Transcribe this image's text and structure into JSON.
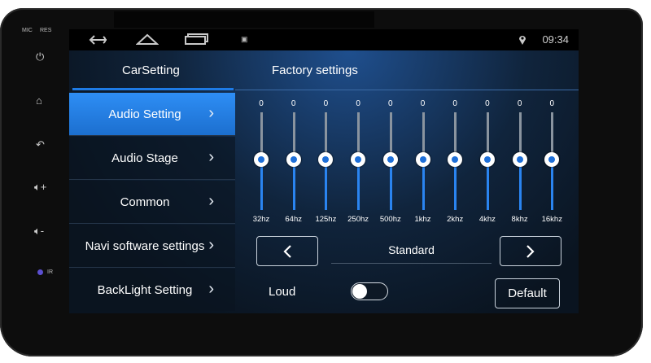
{
  "hardware": {
    "mic_label": "MIC",
    "res_label": "RES",
    "ir_label": "IR"
  },
  "statusbar": {
    "clock": "09:34"
  },
  "tabs": [
    {
      "label": "CarSetting",
      "active": true
    },
    {
      "label": "Factory settings",
      "active": false
    }
  ],
  "menu": [
    {
      "label": "Audio Setting",
      "active": true
    },
    {
      "label": "Audio Stage",
      "active": false
    },
    {
      "label": "Common",
      "active": false
    },
    {
      "label": "Navi software settings",
      "active": false
    },
    {
      "label": "BackLight Setting",
      "active": false
    }
  ],
  "equalizer": {
    "bands": [
      {
        "freq": "32hz",
        "value": "0"
      },
      {
        "freq": "64hz",
        "value": "0"
      },
      {
        "freq": "125hz",
        "value": "0"
      },
      {
        "freq": "250hz",
        "value": "0"
      },
      {
        "freq": "500hz",
        "value": "0"
      },
      {
        "freq": "1khz",
        "value": "0"
      },
      {
        "freq": "2khz",
        "value": "0"
      },
      {
        "freq": "4khz",
        "value": "0"
      },
      {
        "freq": "8khz",
        "value": "0"
      },
      {
        "freq": "16khz",
        "value": "0"
      }
    ],
    "preset": "Standard",
    "loud_label": "Loud",
    "loud_on": false,
    "default_label": "Default"
  },
  "colors": {
    "accent": "#1e7be6",
    "active_item": "#2a86ee"
  }
}
